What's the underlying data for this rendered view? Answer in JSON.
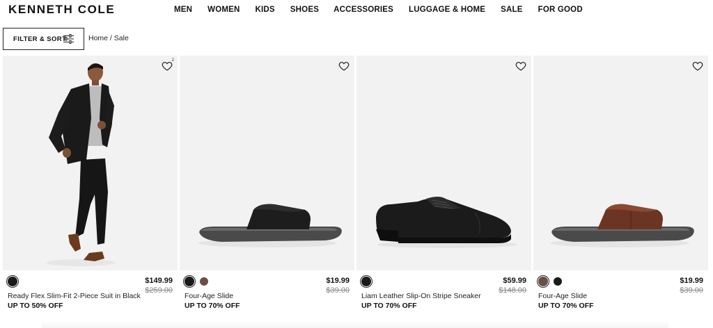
{
  "header": {
    "logo": "KENNETH COLE",
    "nav": [
      "MEN",
      "WOMEN",
      "KIDS",
      "SHOES",
      "ACCESSORIES",
      "LUGGAGE & HOME",
      "SALE",
      "FOR GOOD"
    ]
  },
  "toolbar": {
    "filter_label": "FILTER & SORT",
    "breadcrumb_home": "Home",
    "breadcrumb_sep": " / ",
    "breadcrumb_current": "Sale"
  },
  "products": [
    {
      "name": "Ready Flex Slim-Fit 2-Piece Suit in Black",
      "price": "$149.99",
      "original_price": "$259.00",
      "promo": "UP TO 50% OFF",
      "image": "suit-model",
      "wishlist_count": "2",
      "swatches": [
        "#1a1a1a"
      ]
    },
    {
      "name": "Four-Age Slide",
      "price": "$19.99",
      "original_price": "$39.00",
      "promo": "UP TO 70% OFF",
      "image": "black-slide",
      "swatches": [
        "#1a1a1a",
        "#6b4f45"
      ]
    },
    {
      "name": "Liam Leather Slip-On Stripe Sneaker",
      "price": "$59.99",
      "original_price": "$148.00",
      "promo": "UP TO 70% OFF",
      "image": "black-oxford",
      "swatches": [
        "#1a1a1a"
      ]
    },
    {
      "name": "Four-Age Slide",
      "price": "$19.99",
      "original_price": "$39.00",
      "promo": "UP TO 70% OFF",
      "image": "brown-slide",
      "swatches": [
        "#6b4f45",
        "#1a1a1a"
      ]
    }
  ],
  "colors": {
    "image_bg": "#f2f2f2",
    "text": "#111111",
    "strike_price": "#888888"
  }
}
